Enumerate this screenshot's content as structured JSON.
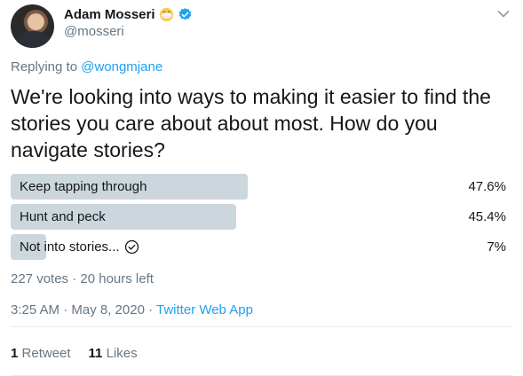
{
  "author": {
    "name": "Adam Mosseri",
    "handle": "@mosseri"
  },
  "reply": {
    "prefix": "Replying to",
    "to": "@wongmjane"
  },
  "tweet": {
    "text": "We're looking into ways to making it easier to find the stories you care about about most. How do you navigate stories?"
  },
  "poll": {
    "choices": [
      {
        "label": "Keep tapping through",
        "percent": "47.6%",
        "fraction": 0.476
      },
      {
        "label": "Hunt and peck",
        "percent": "45.4%",
        "fraction": 0.454
      },
      {
        "label": "Not into stories...",
        "percent": "7%",
        "fraction": 0.07,
        "selected": true
      }
    ],
    "meta": "227 votes · 20 hours left"
  },
  "timestamp": {
    "text": "3:25 AM · May 8, 2020 · ",
    "source": "Twitter Web App"
  },
  "stats": {
    "retweets_count": "1",
    "retweets_label": "Retweet",
    "likes_count": "11",
    "likes_label": "Likes"
  },
  "colors": {
    "link": "#1da1f2",
    "bar": "#ccd6dd",
    "secondary_text": "#657786"
  },
  "icons": [
    "mask-emoji-icon",
    "verified-badge-icon",
    "chevron-down-icon",
    "checkmark-circle-icon"
  ]
}
